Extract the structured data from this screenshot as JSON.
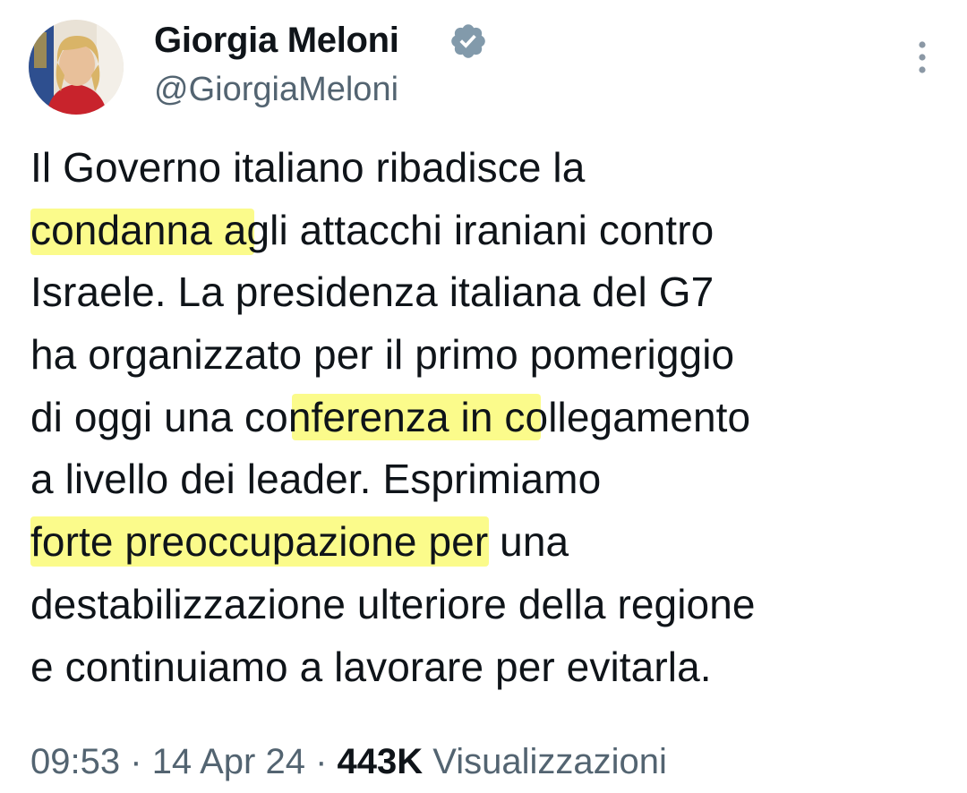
{
  "author": {
    "display_name": "Giorgia Meloni",
    "handle": "@GiorgiaMeloni",
    "avatar_icon": "profile-photo",
    "verified_icon": "verified-badge-icon",
    "verified_color": "#829aab"
  },
  "menu": {
    "icon": "more-options-icon"
  },
  "tweet": {
    "lines": [
      "Il Governo italiano ribadisce la",
      "condanna agli attacchi iraniani contro",
      "Israele. La presidenza italiana del G7",
      "ha organizzato per il primo pomeriggio",
      "di oggi una conferenza in collegamento",
      "a livello dei leader. Esprimiamo",
      "forte preoccupazione per una",
      "destabilizzazione ulteriore della regione",
      "e continuiamo a lavorare per evitarla."
    ],
    "highlighted_phrases": [
      "condanna",
      "conferenza",
      "forte preoccupazione"
    ],
    "highlight_color": "#fafa6e"
  },
  "meta": {
    "time": "09:53",
    "separator": "·",
    "date": "14 Apr 24",
    "views_count": "443K",
    "views_label": "Visualizzazioni"
  }
}
